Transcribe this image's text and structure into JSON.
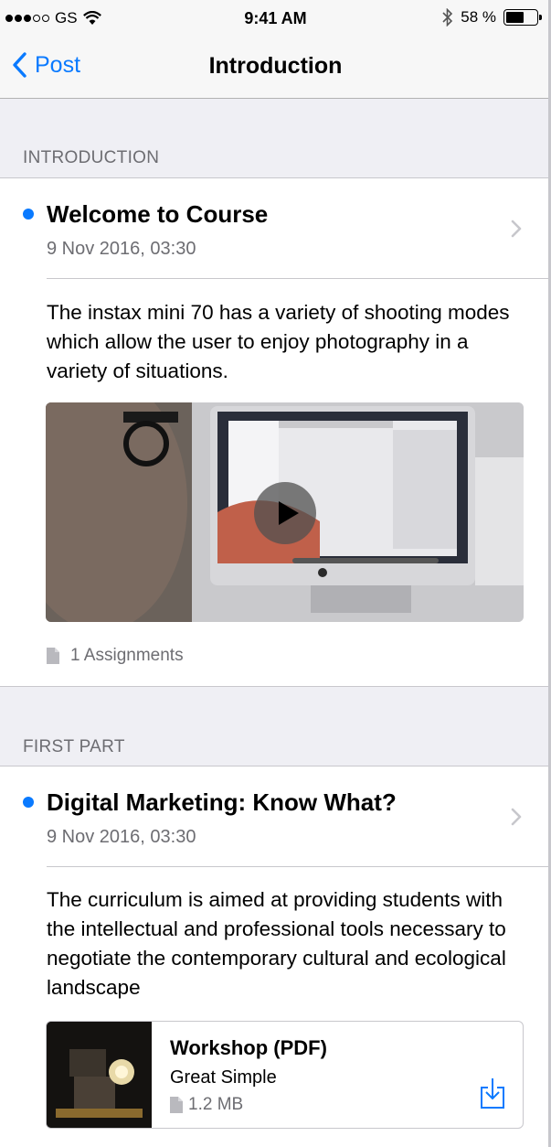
{
  "status_bar": {
    "carrier": "GS",
    "time": "9:41 AM",
    "battery": "58 %",
    "battery_level": 0.58
  },
  "nav": {
    "back_label": "Post",
    "title": "Introduction"
  },
  "sections": [
    {
      "header": "INTRODUCTION",
      "post": {
        "title": "Welcome to Course",
        "date": "9 Nov 2016, 03:30",
        "body": "The instax mini 70 has a variety of shooting modes which allow the user to enjoy photography in a variety of situations.",
        "assignments": "1 Assignments",
        "unread": true
      }
    },
    {
      "header": "FIRST PART",
      "post": {
        "title": "Digital Marketing: Know What?",
        "date": "9 Nov 2016, 03:30",
        "body": "The curriculum is aimed at providing students with the intellectual and professional tools necessary to negotiate the contemporary cultural and ecological landscape",
        "unread": true,
        "attachment": {
          "title": "Workshop (PDF)",
          "subtitle": "Great Simple",
          "size": "1.2 MB"
        }
      }
    }
  ],
  "colors": {
    "accent": "#0a7aff",
    "background": "#efeff4",
    "secondary_text": "#6d6d72"
  }
}
